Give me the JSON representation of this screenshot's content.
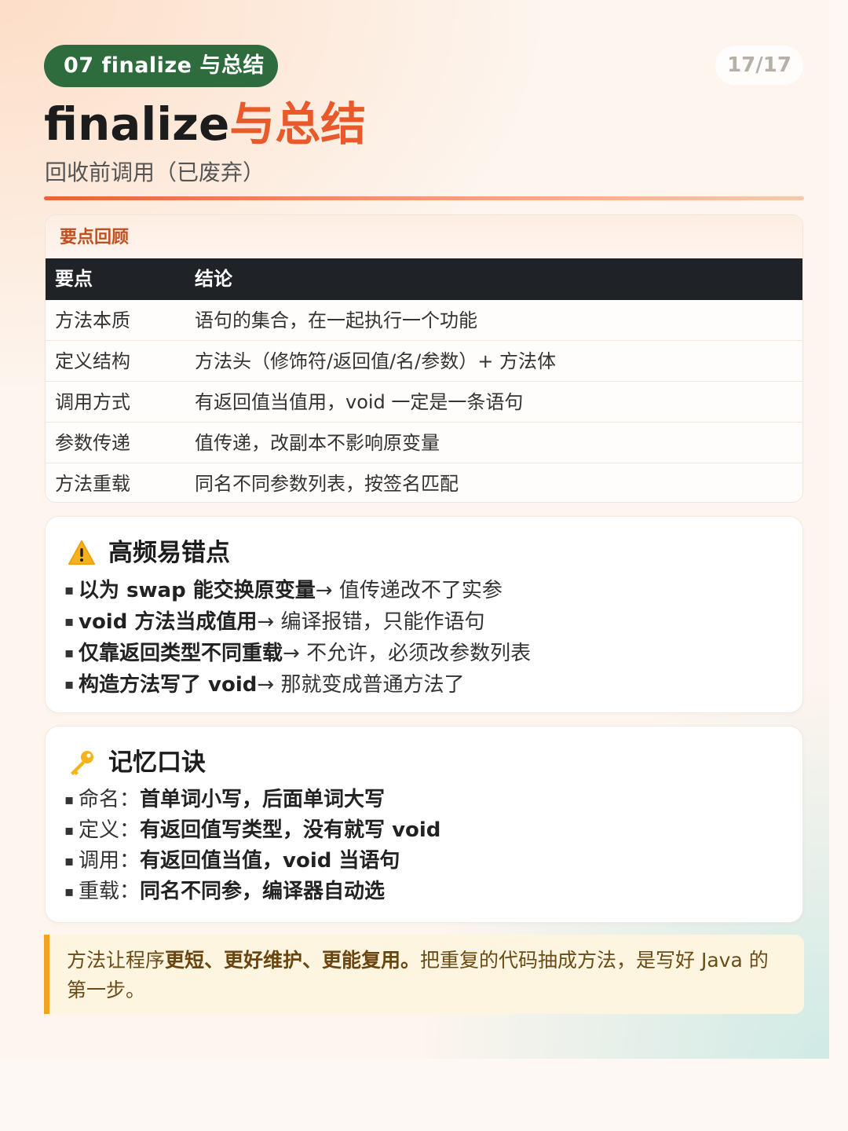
{
  "header": {
    "chip": "07 finalize 与总结",
    "page_number": "17/17",
    "title_part1": "finalize",
    "title_part2": "与总结",
    "subtitle": "回收前调用（已废弃）"
  },
  "summary_table": {
    "caption": "要点回顾",
    "columns": [
      "要点",
      "结论"
    ],
    "rows": [
      [
        "方法本质",
        "语句的集合，在一起执行一个功能"
      ],
      [
        "定义结构",
        "方法头（修饰符/返回值/名/参数）+ 方法体"
      ],
      [
        "调用方式",
        "有返回值当值用，void 一定是一条语句"
      ],
      [
        "参数传递",
        "值传递，改副本不影响原变量"
      ],
      [
        "方法重载",
        "同名不同参数列表，按签名匹配"
      ]
    ]
  },
  "mistakes": {
    "icon": "warning-icon",
    "title": "高频易错点",
    "items": [
      {
        "bold": "以为 swap 能交换原变量",
        "rest": " → 值传递改不了实参"
      },
      {
        "bold": "void 方法当成值用",
        "rest": " → 编译报错，只能作语句"
      },
      {
        "bold": "仅靠返回类型不同重载",
        "rest": " → 不允许，必须改参数列表"
      },
      {
        "bold": "构造方法写了 void",
        "rest": " → 那就变成普通方法了"
      }
    ]
  },
  "mnemonic": {
    "icon": "key-icon",
    "title": "记忆口诀",
    "items": [
      {
        "label": "命名：",
        "bold": "首单词小写，后面单词大写"
      },
      {
        "label": "定义：",
        "bold": "有返回值写类型，没有就写 void"
      },
      {
        "label": "调用：",
        "bold": "有返回值当值，void 当语句"
      },
      {
        "label": "重载：",
        "bold": "同名不同参，编译器自动选"
      }
    ]
  },
  "closing": {
    "pre": "方法让程序",
    "bold": "更短、更好维护、更能复用。",
    "post": "把重复的代码抽成方法，是写好 Java 的第一步。"
  },
  "colors": {
    "chip_green": "#2e6b3d",
    "accent_orange": "#e85a2a",
    "table_header": "#1f2226",
    "quote_bar": "#f5a31a"
  }
}
